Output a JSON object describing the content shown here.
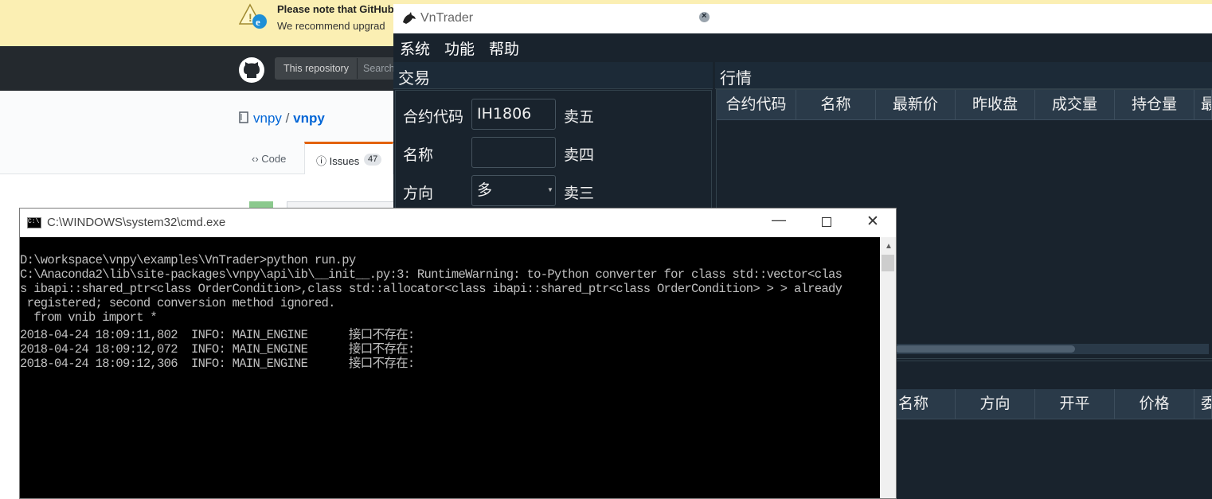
{
  "github": {
    "banner_title": "Please note that GitHub",
    "banner_subtitle": "We recommend upgrad",
    "search_scope": "This repository",
    "search_placeholder": "Search",
    "repo_owner": "vnpy",
    "repo_sep": "/",
    "repo_name": "vnpy",
    "tab_code": "Code",
    "tab_issues": "Issues",
    "issues_count": "47"
  },
  "vntrader": {
    "title": "VnTrader",
    "menu": [
      "系统",
      "功能",
      "帮助"
    ],
    "trade_panel": {
      "title": "交易",
      "fields": [
        {
          "label": "合约代码",
          "value": "IH1806",
          "depth_label": "卖五"
        },
        {
          "label": "名称",
          "value": "",
          "depth_label": "卖四"
        },
        {
          "label": "方向",
          "value": "多",
          "depth_label": "卖三"
        }
      ]
    },
    "market_panel": {
      "title": "行情",
      "columns": [
        "合约代码",
        "名称",
        "最新价",
        "昨收盘",
        "成交量",
        "持仓量",
        "最"
      ]
    },
    "order_table": {
      "columns": [
        "名称",
        "方向",
        "开平",
        "价格",
        "委"
      ]
    }
  },
  "cmd": {
    "title": "C:\\WINDOWS\\system32\\cmd.exe",
    "lines": [
      "D:\\workspace\\vnpy\\examples\\VnTrader>python run.py",
      "C:\\Anaconda2\\lib\\site-packages\\vnpy\\api\\ib\\__init__.py:3: RuntimeWarning: to-Python converter for class std::vector<clas",
      "s ibapi::shared_ptr<class OrderCondition>,class std::allocator<class ibapi::shared_ptr<class OrderCondition> > > already",
      " registered; second conversion method ignored.",
      "  from vnib import *",
      "2018-04-24 18:09:11,802  INFO: MAIN_ENGINE      接口不存在:",
      "2018-04-24 18:09:12,072  INFO: MAIN_ENGINE      接口不存在:",
      "2018-04-24 18:09:12,306  INFO: MAIN_ENGINE      接口不存在:"
    ]
  },
  "colors": {
    "vn_bg": "#19232d",
    "vn_header": "#2a3a49",
    "gh_dark": "#24292e",
    "gh_banner": "#fbefb3",
    "link": "#0366d6",
    "issues_accent": "#e36209"
  },
  "icons": [
    "warning-ie-icon",
    "github-logo-icon",
    "repo-icon",
    "code-icon",
    "issue-icon",
    "vntrader-logo-icon",
    "close-icon",
    "dropdown-arrow-icon",
    "cmd-icon",
    "minimize-icon",
    "maximize-icon",
    "scroll-up-icon"
  ]
}
